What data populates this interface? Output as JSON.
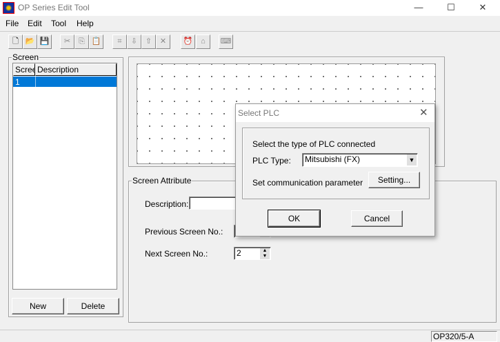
{
  "window": {
    "title": "OP Series Edit Tool",
    "minimize": "—",
    "maximize": "☐",
    "close": "✕"
  },
  "menu": [
    "File",
    "Edit",
    "Tool",
    "Help"
  ],
  "toolbar": [
    {
      "icon": "new-file-icon",
      "glyph": "🗋"
    },
    {
      "icon": "open-folder-icon",
      "glyph": "📂"
    },
    {
      "icon": "save-icon",
      "glyph": "💾"
    },
    {
      "icon": "cut-icon",
      "glyph": "✂"
    },
    {
      "icon": "copy-icon",
      "glyph": "⎘"
    },
    {
      "icon": "paste-icon",
      "glyph": "📋"
    },
    {
      "icon": "screen-icon",
      "glyph": "⌗"
    },
    {
      "icon": "download-icon",
      "glyph": "⇩"
    },
    {
      "icon": "upload-icon",
      "glyph": "⇧"
    },
    {
      "icon": "delete-screen-icon",
      "glyph": "✕"
    },
    {
      "icon": "alarm-icon",
      "glyph": "⏰"
    },
    {
      "icon": "home-icon",
      "glyph": "⌂"
    },
    {
      "icon": "keyboard-icon",
      "glyph": "⌨"
    }
  ],
  "screen_panel": {
    "label": "Screen",
    "columns": [
      "Screen",
      "Description"
    ],
    "rows": [
      {
        "no": "1",
        "description": ""
      }
    ],
    "new_button": "New",
    "delete_button": "Delete"
  },
  "attributes": {
    "label": "Screen Attribute",
    "description_label": "Description:",
    "description_value": "",
    "prev_label": "Previous Screen No.:",
    "prev_value": "",
    "next_label": "Next Screen No.:",
    "next_value": "2"
  },
  "dialog": {
    "title": "Select PLC",
    "prompt": "Select the type of PLC connected",
    "plc_type_label": "PLC Type:",
    "plc_type_value": "Mitsubishi (FX)",
    "comm_label": "Set communication parameter",
    "setting_button": "Setting...",
    "ok_button": "OK",
    "cancel_button": "Cancel"
  },
  "status": {
    "model": "OP320/5-A"
  },
  "colors": {
    "selection": "#0078d7"
  }
}
